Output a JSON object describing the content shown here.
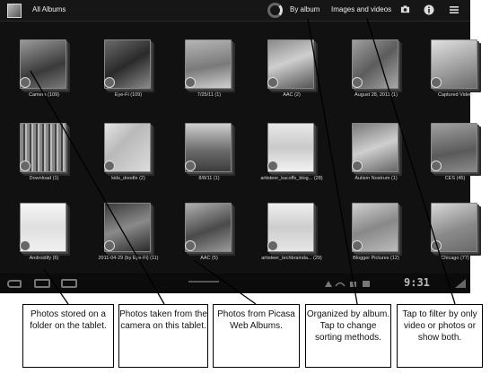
{
  "app": {
    "title": "All Albums"
  },
  "toolbar": {
    "sort_label": "By album",
    "filter_label": "Images and videos",
    "camera_icon": "camera-icon",
    "info_icon": "info-icon",
    "menu_icon": "menu-icon"
  },
  "albums": [
    {
      "label": "Camera (109)",
      "icon": "camera-badge"
    },
    {
      "label": "Eye-Fi (109)",
      "icon": "picasa-badge"
    },
    {
      "label": "7/25/11 (1)",
      "icon": "picasa-badge"
    },
    {
      "label": "AAC (2)",
      "icon": "picasa-badge"
    },
    {
      "label": "August 28, 2011 (1)",
      "icon": "picasa-badge"
    },
    {
      "label": "Captured Video",
      "icon": "picasa-badge"
    },
    {
      "label": "Download (1)",
      "icon": "folder-badge"
    },
    {
      "label": "kids_doodle (2)",
      "icon": "picasa-badge"
    },
    {
      "label": "8/8/11 (1)",
      "icon": "picasa-badge"
    },
    {
      "label": "artisteer_kacsffs_blog... (28)",
      "icon": "picasa-badge"
    },
    {
      "label": "Autism Nostrum (1)",
      "icon": "picasa-badge"
    },
    {
      "label": "CES (45)",
      "icon": "picasa-badge"
    },
    {
      "label": "Androidify (6)",
      "icon": "folder-badge"
    },
    {
      "label": "2011-04-29 (by Eye-Fi) (11)",
      "icon": "picasa-badge"
    },
    {
      "label": "AAC (5)",
      "icon": "picasa-badge"
    },
    {
      "label": "artisteer_techbrainda... (29)",
      "icon": "picasa-badge"
    },
    {
      "label": "Blogger Pictures (12)",
      "icon": "picasa-badge"
    },
    {
      "label": "Chicago (77)",
      "icon": "picasa-badge"
    }
  ],
  "status_bar": {
    "clock": "9:31"
  },
  "callouts": [
    "Photos stored on a folder on the tablet.",
    "Photos taken from the camera on this tablet.",
    "Photos from Picasa Web Albums.",
    "Organized by album. Tap to change sorting methods.",
    "Tap to filter by only video or photos or show both."
  ]
}
